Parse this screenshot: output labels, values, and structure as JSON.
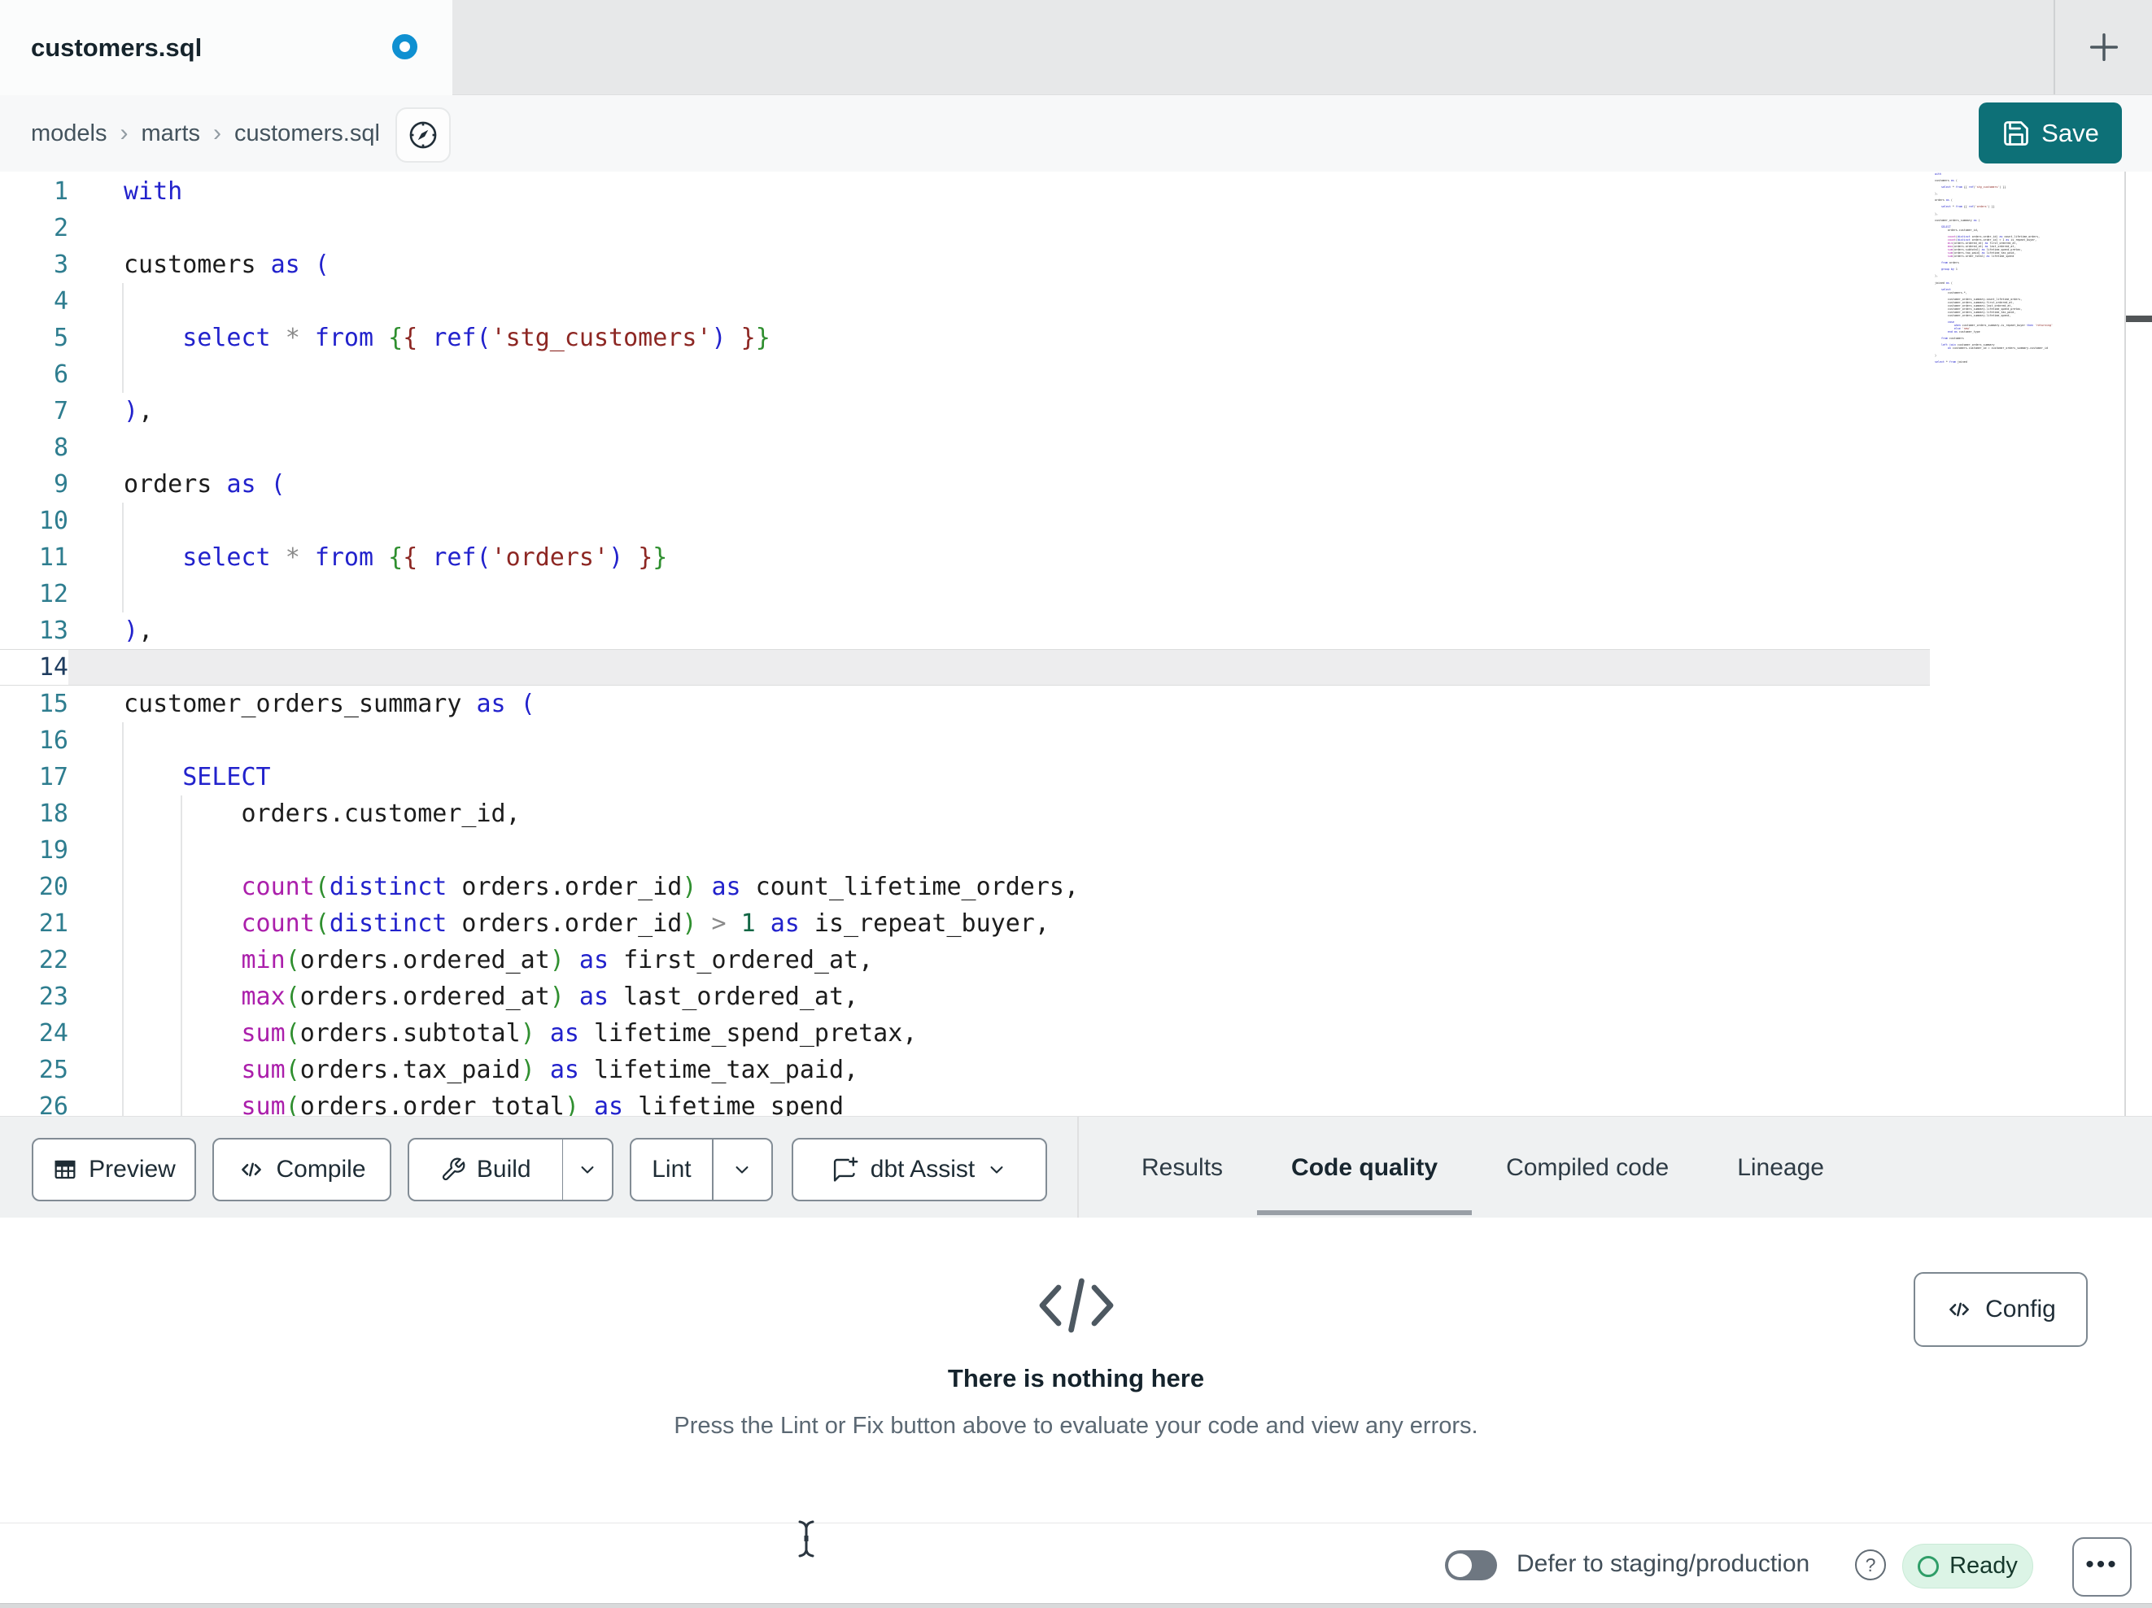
{
  "tab_bar": {
    "title": "customers.sql"
  },
  "breadcrumb": {
    "items": [
      "models",
      "marts",
      "customers.sql"
    ]
  },
  "header": {
    "save_label": "Save"
  },
  "colors": {
    "accent_teal": "#0d7077",
    "unsaved_dot_blue": "#0f90d1",
    "ready_bg_green": "#dcf4e6",
    "ready_green": "#2f9e68",
    "active_tab_underline": "#999fa6"
  },
  "editor": {
    "gutter_color": "#2e7d8f",
    "gutter_active_color": "#1d3b5e",
    "active_line": 14,
    "syntax_colors": {
      "p": "#1c1c1c",
      "k": "#2222cc",
      "f": "#ab1fab",
      "s": "#8d2723",
      "n": "#116644",
      "o": "#8a8a8a",
      "bb": "#2222cc",
      "bg": "#2f8f2f",
      "bm": "#8d2723"
    },
    "guides": [
      {
        "ch": 0,
        "from": 4,
        "to": 6
      },
      {
        "ch": 0,
        "from": 10,
        "to": 12
      },
      {
        "ch": 0,
        "from": 16,
        "to": 26
      },
      {
        "ch": 4,
        "from": 18,
        "to": 26
      }
    ],
    "lines": [
      {
        "n": 1,
        "tokens": [
          [
            "k",
            "with"
          ]
        ]
      },
      {
        "n": 2,
        "tokens": []
      },
      {
        "n": 3,
        "tokens": [
          [
            "p",
            "customers "
          ],
          [
            "k",
            "as"
          ],
          [
            "p",
            " "
          ],
          [
            "bb",
            "("
          ]
        ]
      },
      {
        "n": 4,
        "tokens": []
      },
      {
        "n": 5,
        "tokens": [
          [
            "p",
            "    "
          ],
          [
            "k",
            "select"
          ],
          [
            "p",
            " "
          ],
          [
            "o",
            "*"
          ],
          [
            "p",
            " "
          ],
          [
            "k",
            "from"
          ],
          [
            "p",
            " "
          ],
          [
            "bg",
            "{"
          ],
          [
            "bm",
            "{"
          ],
          [
            "p",
            " "
          ],
          [
            "k",
            "ref"
          ],
          [
            "bb",
            "("
          ],
          [
            "s",
            "'stg_customers'"
          ],
          [
            "bb",
            ")"
          ],
          [
            "p",
            " "
          ],
          [
            "bm",
            "}"
          ],
          [
            "bg",
            "}"
          ]
        ]
      },
      {
        "n": 6,
        "tokens": []
      },
      {
        "n": 7,
        "tokens": [
          [
            "bb",
            ")"
          ],
          [
            "p",
            ","
          ]
        ]
      },
      {
        "n": 8,
        "tokens": []
      },
      {
        "n": 9,
        "tokens": [
          [
            "p",
            "orders "
          ],
          [
            "k",
            "as"
          ],
          [
            "p",
            " "
          ],
          [
            "bb",
            "("
          ]
        ]
      },
      {
        "n": 10,
        "tokens": []
      },
      {
        "n": 11,
        "tokens": [
          [
            "p",
            "    "
          ],
          [
            "k",
            "select"
          ],
          [
            "p",
            " "
          ],
          [
            "o",
            "*"
          ],
          [
            "p",
            " "
          ],
          [
            "k",
            "from"
          ],
          [
            "p",
            " "
          ],
          [
            "bg",
            "{"
          ],
          [
            "bm",
            "{"
          ],
          [
            "p",
            " "
          ],
          [
            "k",
            "ref"
          ],
          [
            "bb",
            "("
          ],
          [
            "s",
            "'orders'"
          ],
          [
            "bb",
            ")"
          ],
          [
            "p",
            " "
          ],
          [
            "bm",
            "}"
          ],
          [
            "bg",
            "}"
          ]
        ]
      },
      {
        "n": 12,
        "tokens": []
      },
      {
        "n": 13,
        "tokens": [
          [
            "bb",
            ")"
          ],
          [
            "p",
            ","
          ]
        ]
      },
      {
        "n": 14,
        "tokens": []
      },
      {
        "n": 15,
        "tokens": [
          [
            "p",
            "customer_orders_summary "
          ],
          [
            "k",
            "as"
          ],
          [
            "p",
            " "
          ],
          [
            "bb",
            "("
          ]
        ]
      },
      {
        "n": 16,
        "tokens": []
      },
      {
        "n": 17,
        "tokens": [
          [
            "p",
            "    "
          ],
          [
            "k",
            "SELECT"
          ]
        ]
      },
      {
        "n": 18,
        "tokens": [
          [
            "p",
            "        orders.customer_id,"
          ]
        ]
      },
      {
        "n": 19,
        "tokens": []
      },
      {
        "n": 20,
        "tokens": [
          [
            "p",
            "        "
          ],
          [
            "f",
            "count"
          ],
          [
            "bg",
            "("
          ],
          [
            "k",
            "distinct"
          ],
          [
            "p",
            " orders.order_id"
          ],
          [
            "bg",
            ")"
          ],
          [
            "p",
            " "
          ],
          [
            "k",
            "as"
          ],
          [
            "p",
            " count_lifetime_orders,"
          ]
        ]
      },
      {
        "n": 21,
        "tokens": [
          [
            "p",
            "        "
          ],
          [
            "f",
            "count"
          ],
          [
            "bg",
            "("
          ],
          [
            "k",
            "distinct"
          ],
          [
            "p",
            " orders.order_id"
          ],
          [
            "bg",
            ")"
          ],
          [
            "p",
            " "
          ],
          [
            "o",
            ">"
          ],
          [
            "p",
            " "
          ],
          [
            "n",
            "1"
          ],
          [
            "p",
            " "
          ],
          [
            "k",
            "as"
          ],
          [
            "p",
            " is_repeat_buyer,"
          ]
        ]
      },
      {
        "n": 22,
        "tokens": [
          [
            "p",
            "        "
          ],
          [
            "f",
            "min"
          ],
          [
            "bg",
            "("
          ],
          [
            "p",
            "orders.ordered_at"
          ],
          [
            "bg",
            ")"
          ],
          [
            "p",
            " "
          ],
          [
            "k",
            "as"
          ],
          [
            "p",
            " first_ordered_at,"
          ]
        ]
      },
      {
        "n": 23,
        "tokens": [
          [
            "p",
            "        "
          ],
          [
            "f",
            "max"
          ],
          [
            "bg",
            "("
          ],
          [
            "p",
            "orders.ordered_at"
          ],
          [
            "bg",
            ")"
          ],
          [
            "p",
            " "
          ],
          [
            "k",
            "as"
          ],
          [
            "p",
            " last_ordered_at,"
          ]
        ]
      },
      {
        "n": 24,
        "tokens": [
          [
            "p",
            "        "
          ],
          [
            "f",
            "sum"
          ],
          [
            "bg",
            "("
          ],
          [
            "p",
            "orders.subtotal"
          ],
          [
            "bg",
            ")"
          ],
          [
            "p",
            " "
          ],
          [
            "k",
            "as"
          ],
          [
            "p",
            " lifetime_spend_pretax,"
          ]
        ]
      },
      {
        "n": 25,
        "tokens": [
          [
            "p",
            "        "
          ],
          [
            "f",
            "sum"
          ],
          [
            "bg",
            "("
          ],
          [
            "p",
            "orders.tax_paid"
          ],
          [
            "bg",
            ")"
          ],
          [
            "p",
            " "
          ],
          [
            "k",
            "as"
          ],
          [
            "p",
            " lifetime_tax_paid,"
          ]
        ]
      },
      {
        "n": 26,
        "tokens": [
          [
            "p",
            "        "
          ],
          [
            "f",
            "sum"
          ],
          [
            "bg",
            "("
          ],
          [
            "p",
            "orders.order_total"
          ],
          [
            "bg",
            ")"
          ],
          [
            "p",
            " "
          ],
          [
            "k",
            "as"
          ],
          [
            "p",
            " lifetime_spend"
          ]
        ]
      }
    ],
    "minimap_lines": [
      "with",
      "",
      "customers as (",
      "",
      "    select * from {{ ref('stg_customers') }}",
      "",
      "),",
      "",
      "orders as (",
      "",
      "    select * from {{ ref('orders') }}",
      "",
      "),",
      "",
      "customer_orders_summary as (",
      "",
      "    SELECT",
      "        orders.customer_id,",
      "",
      "        count(distinct orders.order_id) as count_lifetime_orders,",
      "        count(distinct orders.order_id) > 1 as is_repeat_buyer,",
      "        min(orders.ordered_at) as first_ordered_at,",
      "        max(orders.ordered_at) as last_ordered_at,",
      "        sum(orders.subtotal) as lifetime_spend_pretax,",
      "        sum(orders.tax_paid) as lifetime_tax_paid,",
      "        sum(orders.order_total) as lifetime_spend",
      "",
      "    from orders",
      "",
      "    group by 1",
      "",
      "),",
      "",
      "joined as (",
      "",
      "    select",
      "        customers.*,",
      "",
      "        customer_orders_summary.count_lifetime_orders,",
      "        customer_orders_summary.first_ordered_at,",
      "        customer_orders_summary.last_ordered_at,",
      "        customer_orders_summary.lifetime_spend_pretax,",
      "        customer_orders_summary.lifetime_tax_paid,",
      "        customer_orders_summary.lifetime_spend,",
      "",
      "        case",
      "            when customer_orders_summary.is_repeat_buyer then 'returning'",
      "            else 'new'",
      "        end as customer_type",
      "",
      "    from customers",
      "",
      "    left join customer_orders_summary",
      "        on customers.customer_id = customer_orders_summary.customer_id",
      "",
      ")",
      "",
      "select * from joined"
    ]
  },
  "toolbar": {
    "preview": "Preview",
    "compile": "Compile",
    "build": "Build",
    "lint": "Lint",
    "assist": "dbt Assist"
  },
  "panel_tabs": [
    {
      "label": "Results",
      "active": false
    },
    {
      "label": "Code quality",
      "active": true
    },
    {
      "label": "Compiled code",
      "active": false
    },
    {
      "label": "Lineage",
      "active": false
    }
  ],
  "empty_state": {
    "title": "There is nothing here",
    "subtitle": "Press the Lint or Fix button above to evaluate your code and view any errors.",
    "config_label": "Config"
  },
  "status_bar": {
    "defer_label": "Defer to staging/production",
    "help_glyph": "?",
    "ready_label": "Ready",
    "more_glyph": "•••"
  }
}
